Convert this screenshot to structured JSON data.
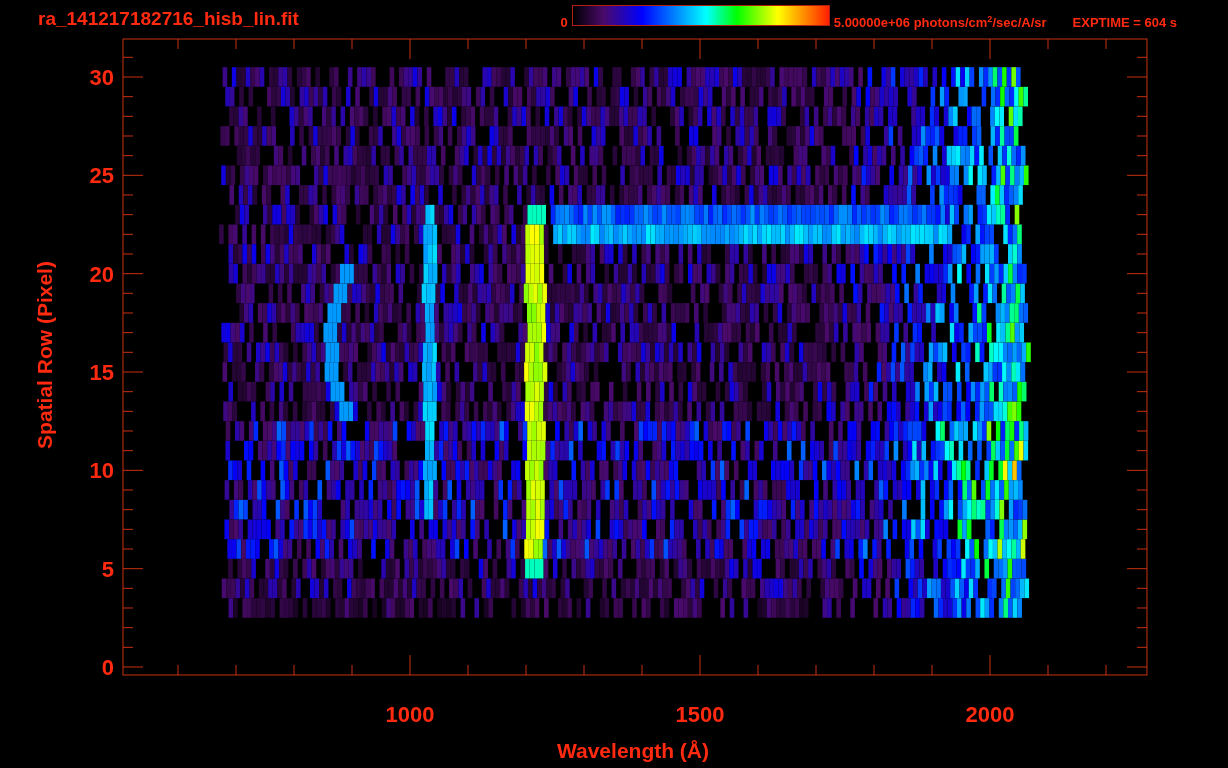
{
  "title": "ra_141217182716_hisb_lin.fit",
  "colorbar": {
    "min_label": "0",
    "max_label": "5.00000e+06 photons/cm$^{2}$/sec/A/sr"
  },
  "exposure": "EXPTIME = 604 s",
  "plot": {
    "xlabel": "Wavelength (Å)",
    "ylabel": "Spatial Row (Pixel)",
    "xticks": [
      "1000",
      "1500",
      "2000"
    ],
    "yticks": [
      "30",
      "25",
      "20",
      "15",
      "10",
      "5",
      "0"
    ]
  }
}
